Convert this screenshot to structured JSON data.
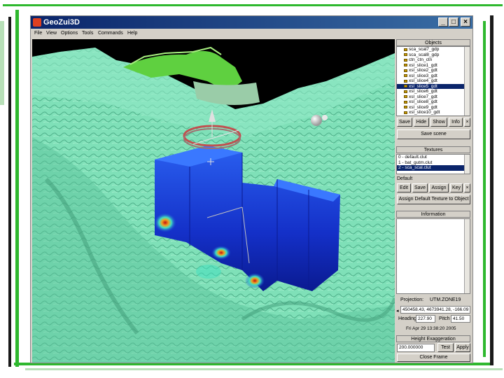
{
  "window": {
    "title": "GeoZui3D",
    "controls": {
      "minimize": "_",
      "maximize": "□",
      "close": "×"
    }
  },
  "menu": [
    "File",
    "View",
    "Options",
    "Tools",
    "Commands",
    "Help"
  ],
  "objects_panel": {
    "title": "Objects",
    "items": [
      {
        "label": "sca_scal7_gdp",
        "selected": false
      },
      {
        "label": "sca_scal8_gdp",
        "selected": false
      },
      {
        "label": "ctn_ctn_ctn",
        "selected": false
      },
      {
        "label": "xsl_slice1_gdt",
        "selected": false
      },
      {
        "label": "xsl_slice2_gdt",
        "selected": false
      },
      {
        "label": "xsl_slice3_gdt",
        "selected": false
      },
      {
        "label": "xsl_slice4_gdt",
        "selected": false
      },
      {
        "label": "xsl_slice5_gdt",
        "selected": true
      },
      {
        "label": "xsl_slice6_gdt",
        "selected": false
      },
      {
        "label": "xsl_slice7_gdt",
        "selected": false
      },
      {
        "label": "xsl_slice8_gdt",
        "selected": false
      },
      {
        "label": "xsl_slice9_gdt",
        "selected": false
      },
      {
        "label": "xsl_slice10_gdt",
        "selected": false
      }
    ],
    "buttons": {
      "save": "Save",
      "hide": "Hide",
      "show": "Show",
      "info": "Info",
      "close": "×"
    },
    "save_scene": "Save scene"
  },
  "textures_panel": {
    "title": "Textures",
    "items": [
      {
        "label": "0 - default.clut",
        "selected": false
      },
      {
        "label": "1 - bat_gutm.clut",
        "selected": false
      },
      {
        "label": "2 - sca_scal.clut",
        "selected": true
      }
    ],
    "default_label": "Default",
    "buttons": {
      "edit": "Edit",
      "save": "Save",
      "assign": "Assign",
      "key": "Key",
      "close": "×"
    },
    "assign_default": "Assign Default Texture to Object"
  },
  "information_panel": {
    "title": "Information"
  },
  "projection": {
    "label": "Projection:",
    "value": "UTM.ZONE19",
    "coords": "450458.43, 4673941.28, -166.09",
    "heading_label": "Heading",
    "heading_value": "227.90",
    "pitch_label": "Pitch",
    "pitch_value": "41.50",
    "timestamp": "Fri Apr 29 13:38:20 2005"
  },
  "height_panel": {
    "title": "Height Exaggeration",
    "value": "200.000000",
    "test_button": "Test",
    "apply_button": "Apply"
  },
  "close_frame": "Close Frame",
  "colors": {
    "slide_green": "#2eb82e",
    "terrain": "#7fe0b8",
    "volume": "#1a40d8",
    "titlebar": "#0a246a"
  }
}
